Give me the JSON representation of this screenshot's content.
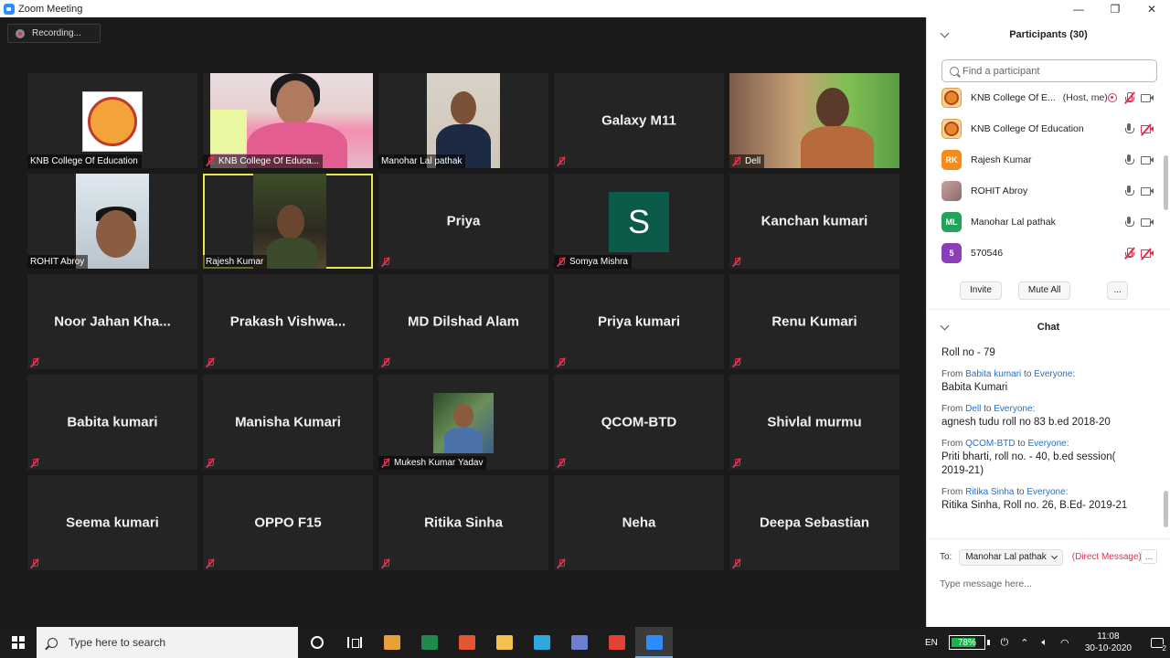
{
  "window": {
    "title": "Zoom Meeting",
    "minimize_glyph": "—",
    "maximize_glyph": "❐",
    "close_glyph": "✕"
  },
  "recording": {
    "label": "Recording..."
  },
  "tiles": [
    {
      "name": "KNB College Of Education",
      "mic_muted": false,
      "thumb": "logo"
    },
    {
      "name": "KNB College Of Educa...",
      "mic_muted": true,
      "thumb": "video1"
    },
    {
      "name": "Manohar Lal pathak",
      "mic_muted": false,
      "thumb": "video2"
    },
    {
      "name": "Galaxy M11",
      "mic_muted": true,
      "thumb": "none"
    },
    {
      "name": "Dell",
      "mic_muted": true,
      "thumb": "video3"
    },
    {
      "name": "ROHIT Abroy",
      "mic_muted": false,
      "thumb": "video4"
    },
    {
      "name": "Rajesh Kumar",
      "mic_muted": false,
      "thumb": "video5",
      "active": true
    },
    {
      "name": "Priya",
      "mic_muted": true,
      "thumb": "none"
    },
    {
      "name": "Somya Mishra",
      "mic_muted": true,
      "thumb": "letter",
      "letter": "S"
    },
    {
      "name": "Kanchan kumari",
      "mic_muted": true,
      "thumb": "none"
    },
    {
      "name": "Noor Jahan Kha...",
      "mic_muted": true,
      "thumb": "none"
    },
    {
      "name": "Prakash Vishwa...",
      "mic_muted": true,
      "thumb": "none"
    },
    {
      "name": "MD Dilshad Alam",
      "mic_muted": true,
      "thumb": "none"
    },
    {
      "name": "Priya kumari",
      "mic_muted": true,
      "thumb": "none"
    },
    {
      "name": "Renu Kumari",
      "mic_muted": true,
      "thumb": "none"
    },
    {
      "name": "Babita kumari",
      "mic_muted": true,
      "thumb": "none"
    },
    {
      "name": "Manisha Kumari",
      "mic_muted": true,
      "thumb": "none"
    },
    {
      "name": "Mukesh Kumar Yadav",
      "mic_muted": true,
      "thumb": "photo"
    },
    {
      "name": "QCOM-BTD",
      "mic_muted": true,
      "thumb": "none"
    },
    {
      "name": "Shivlal murmu",
      "mic_muted": true,
      "thumb": "none"
    },
    {
      "name": "Seema kumari",
      "mic_muted": true,
      "thumb": "none"
    },
    {
      "name": "OPPO F15",
      "mic_muted": true,
      "thumb": "none"
    },
    {
      "name": "Ritika Sinha",
      "mic_muted": true,
      "thumb": "none"
    },
    {
      "name": "Neha",
      "mic_muted": true,
      "thumb": "none"
    },
    {
      "name": "Deepa Sebastian",
      "mic_muted": true,
      "thumb": "none"
    }
  ],
  "participants": {
    "title": "Participants (30)",
    "search_placeholder": "Find a participant",
    "list": [
      {
        "name": "KNB College Of E...",
        "tag": "(Host, me)",
        "avatar": "logo",
        "avatar_text": "",
        "recording": true,
        "mic": "off",
        "cam": "on"
      },
      {
        "name": "KNB College Of Education",
        "tag": "",
        "avatar": "logo",
        "avatar_text": "",
        "recording": false,
        "mic": "on",
        "cam": "off"
      },
      {
        "name": "Rajesh Kumar",
        "tag": "",
        "avatar": "initials",
        "avatar_text": "RK",
        "avatar_color": "#f28c1a",
        "recording": false,
        "mic": "on",
        "cam": "on"
      },
      {
        "name": "ROHIT Abroy",
        "tag": "",
        "avatar": "photo",
        "avatar_text": "",
        "recording": false,
        "mic": "on",
        "cam": "on"
      },
      {
        "name": "Manohar Lal pathak",
        "tag": "",
        "avatar": "initials",
        "avatar_text": "ML",
        "avatar_color": "#23a35a",
        "recording": false,
        "mic": "on",
        "cam": "on"
      },
      {
        "name": "570546",
        "tag": "",
        "avatar": "initials",
        "avatar_text": "5",
        "avatar_color": "#8a3fb8",
        "recording": false,
        "mic": "off",
        "cam": "off"
      }
    ],
    "invite_label": "Invite",
    "mute_all_label": "Mute All",
    "more_label": "..."
  },
  "chat": {
    "title": "Chat",
    "messages": [
      {
        "from": "",
        "to": "",
        "text": "Roll no - 79"
      },
      {
        "from": "Babita kumari",
        "to": "Everyone",
        "text": "Babita Kumari"
      },
      {
        "from": "Dell",
        "to": "Everyone",
        "text": "agnesh tudu roll no 83 b.ed 2018-20"
      },
      {
        "from": "QCOM-BTD",
        "to": "Everyone",
        "text": "Priti bharti, roll no. - 40, b.ed session( 2019-21)"
      },
      {
        "from": "Ritika Sinha",
        "to": "Everyone",
        "text": "Ritika Sinha, Roll no. 26, B.Ed- 2019-21"
      }
    ],
    "from_word": "From",
    "to_word": "to",
    "to_label": "To:",
    "recipient": "Manohar Lal pathak",
    "direct_label": "(Direct Message)",
    "more_label": "...",
    "input_placeholder": "Type message here..."
  },
  "taskbar": {
    "search_placeholder": "Type here to search",
    "apps": [
      {
        "name": "store",
        "color": "#e8a13a"
      },
      {
        "name": "excel",
        "color": "#1f8a4c"
      },
      {
        "name": "ie-edit",
        "color": "#e4572e"
      },
      {
        "name": "file-explorer",
        "color": "#f2c14e"
      },
      {
        "name": "edge",
        "color": "#2fa8e0"
      },
      {
        "name": "photo-app",
        "color": "#6c7fd1"
      },
      {
        "name": "chrome",
        "color": "#e34133"
      },
      {
        "name": "zoom",
        "color": "#2d8cff"
      }
    ],
    "lang": "EN",
    "battery": "78%",
    "battery_level": 0.78,
    "time": "11:08",
    "date": "30-10-2020",
    "notification_count": "2"
  }
}
